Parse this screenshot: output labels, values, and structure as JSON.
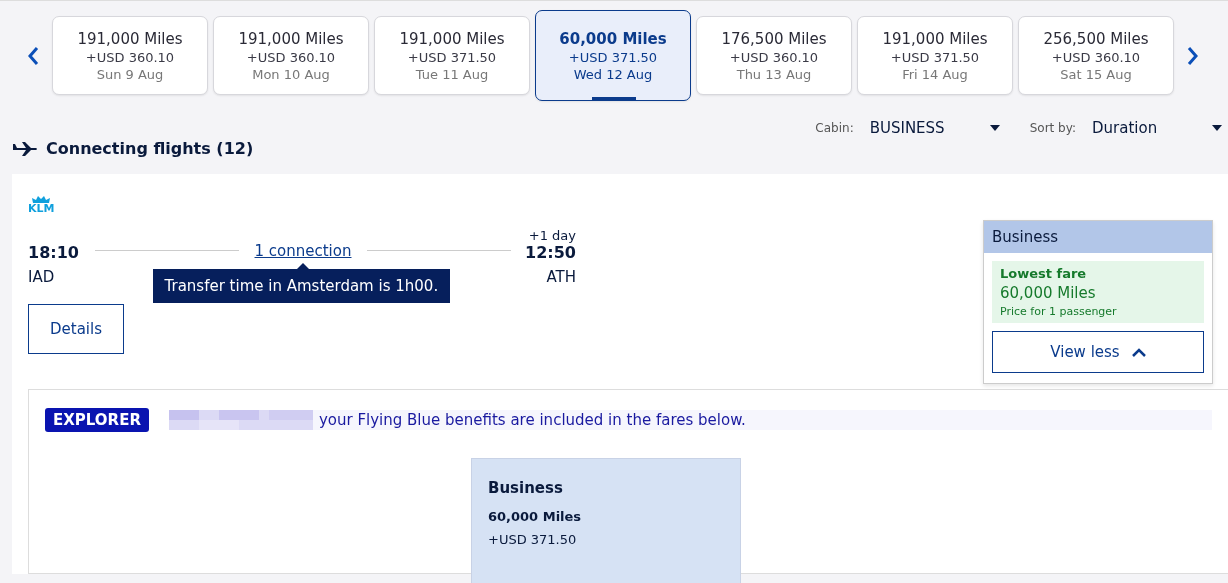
{
  "dates": [
    {
      "miles": "191,000 Miles",
      "price": "+USD 360.10",
      "date": "Sun 9 Aug",
      "selected": false
    },
    {
      "miles": "191,000 Miles",
      "price": "+USD 360.10",
      "date": "Mon 10 Aug",
      "selected": false
    },
    {
      "miles": "191,000 Miles",
      "price": "+USD 371.50",
      "date": "Tue 11 Aug",
      "selected": false
    },
    {
      "miles": "60,000 Miles",
      "price": "+USD 371.50",
      "date": "Wed 12 Aug",
      "selected": true
    },
    {
      "miles": "176,500 Miles",
      "price": "+USD 360.10",
      "date": "Thu 13 Aug",
      "selected": false
    },
    {
      "miles": "191,000 Miles",
      "price": "+USD 371.50",
      "date": "Fri 14 Aug",
      "selected": false
    },
    {
      "miles": "256,500 Miles",
      "price": "+USD 360.10",
      "date": "Sat 15 Aug",
      "selected": false
    }
  ],
  "filters": [
    {
      "label": "Cabin:",
      "value": "BUSINESS"
    },
    {
      "label": "Sort by:",
      "value": "Duration"
    }
  ],
  "heading": "Connecting flights (12)",
  "flight": {
    "logo_text": "KLM",
    "depart_time": "18:10",
    "depart_airport": "IAD",
    "connection": "1 connection",
    "tooltip": "Transfer time in Amsterdam is 1h00.",
    "day_offset": "+1 day",
    "arrive_time": "12:50",
    "arrive_airport": "ATH",
    "details_button": "Details"
  },
  "fare_popup": {
    "cabin": "Business",
    "badge": "Lowest fare",
    "miles": "60,000 Miles",
    "note": "Price for 1 passenger",
    "button": "View less"
  },
  "explorer": {
    "tier": "EXPLORER",
    "message": "your Flying Blue benefits are included in the fares below.",
    "fare": {
      "cabin": "Business",
      "miles": "60,000 Miles",
      "price": "+USD 371.50"
    }
  }
}
